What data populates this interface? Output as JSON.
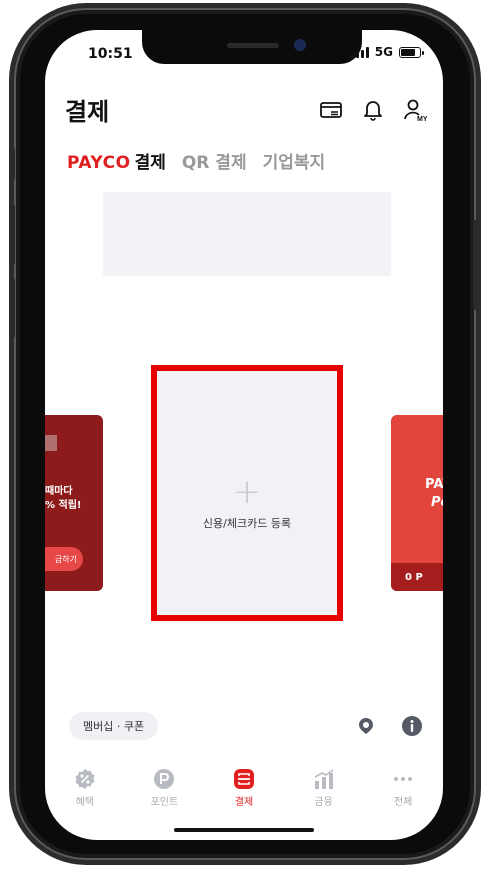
{
  "status": {
    "time": "10:51",
    "network": "5G"
  },
  "header": {
    "title": "결제"
  },
  "tabs": [
    {
      "brand": "PAYCO",
      "suffix": "결제",
      "active": true
    },
    {
      "label": "QR 결제"
    },
    {
      "label": "기업복지"
    }
  ],
  "cards": {
    "left": {
      "text_line1": "때마다",
      "text_line2": "% 적립!",
      "button": "급하기"
    },
    "main": {
      "plus": "+",
      "label": "신용/체크카드 등록"
    },
    "right": {
      "brand": "PAY",
      "sub": "Po",
      "points": "0 P"
    }
  },
  "membership": {
    "label": "멤버십 · 쿠폰"
  },
  "bottom_nav": [
    {
      "label": "혜택",
      "icon": "percent-icon"
    },
    {
      "label": "포인트",
      "icon": "point-icon"
    },
    {
      "label": "결제",
      "icon": "pay-icon",
      "active": true
    },
    {
      "label": "금융",
      "icon": "chart-icon"
    },
    {
      "label": "전체",
      "icon": "more-icon"
    }
  ],
  "colors": {
    "accent": "#e02020",
    "highlight": "#e60000",
    "card_left": "#8e1b1b",
    "card_right": "#e2453c"
  }
}
